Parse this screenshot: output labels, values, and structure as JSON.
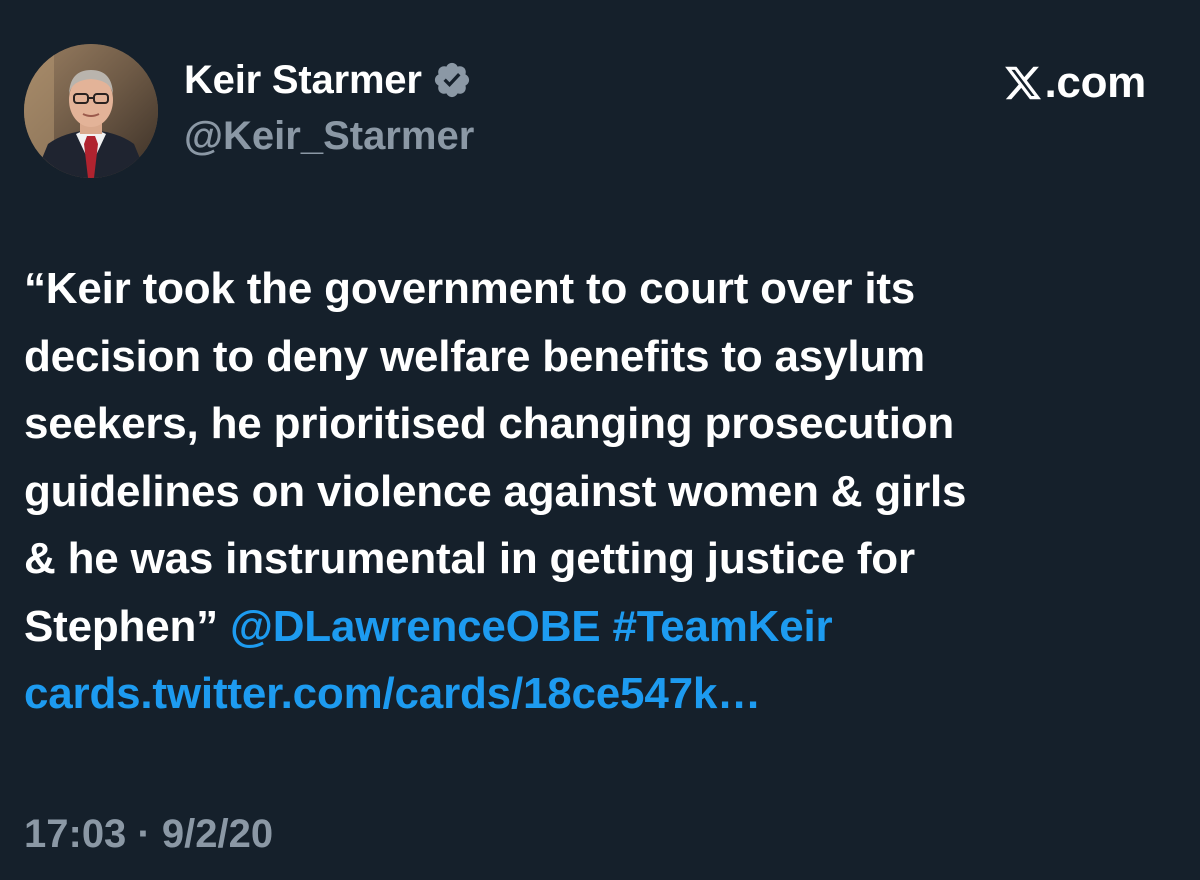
{
  "author": {
    "name": "Keir Starmer",
    "handle": "@Keir_Starmer",
    "verified": true,
    "avatar_icon": "profile-photo"
  },
  "brand": {
    "icon": "x-logo-icon",
    "text": ".com"
  },
  "tweet": {
    "lines": [
      "“Keir took the government to court over its",
      "decision to deny welfare benefits to asylum",
      "seekers, he prioritised changing prosecution",
      "guidelines on violence against women & girls",
      "& he was instrumental in getting justice for"
    ],
    "last_line_text": "Stephen”",
    "mention": "@DLawrenceOBE",
    "hashtag": "#TeamKeir",
    "card_link": "cards.twitter.com/cards/18ce547k…"
  },
  "timestamp": "17:03 · 9/2/20",
  "colors": {
    "background": "#15202b",
    "text": "#ffffff",
    "secondary": "#8b98a5",
    "link": "#1d9bf0",
    "verified_badge": "#8b98a5"
  }
}
